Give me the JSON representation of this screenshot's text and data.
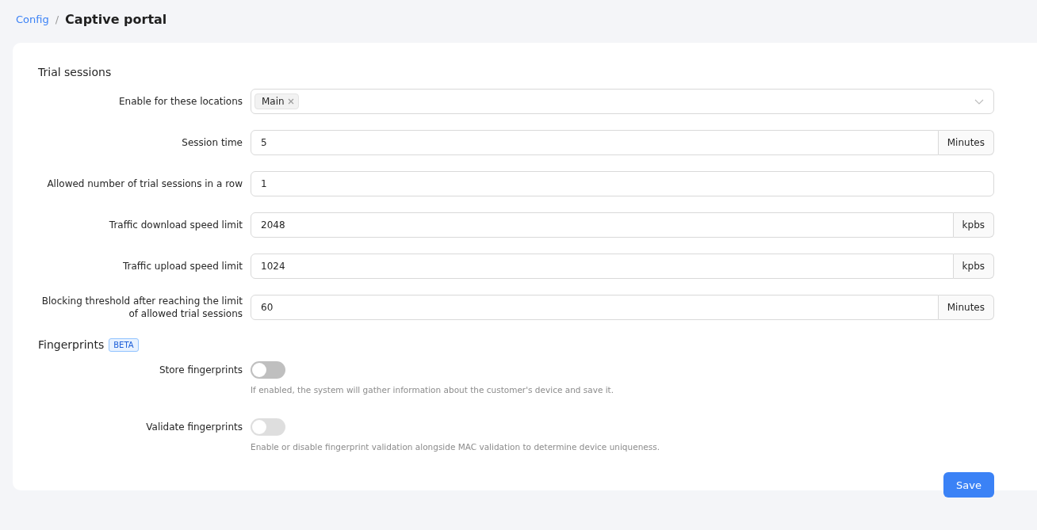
{
  "breadcrumb": {
    "parent": "Config",
    "separator": "/",
    "title": "Captive portal"
  },
  "sections": [
    {
      "title": "Trial sessions",
      "fields": [
        {
          "kind": "multiselect",
          "label": "Enable for these locations",
          "tags": [
            "Main"
          ]
        },
        {
          "kind": "input",
          "label": "Session time",
          "value": "5",
          "suffix": "Minutes"
        },
        {
          "kind": "input",
          "label": "Allowed number of trial sessions in a row",
          "value": "1"
        },
        {
          "kind": "input",
          "label": "Traffic download speed limit",
          "value": "2048",
          "suffix": "kpbs"
        },
        {
          "kind": "input",
          "label": "Traffic upload speed limit",
          "value": "1024",
          "suffix": "kpbs"
        },
        {
          "kind": "input",
          "label": "Blocking threshold after reaching the limit of allowed trial sessions",
          "value": "60",
          "suffix": "Minutes"
        }
      ]
    },
    {
      "title": "Fingerprints",
      "badge": "BETA",
      "fields": [
        {
          "kind": "toggle",
          "label": "Store fingerprints",
          "on": false,
          "disabled": false,
          "help": "If enabled, the system will gather information about the customer's device and save it."
        },
        {
          "kind": "toggle",
          "label": "Validate fingerprints",
          "on": false,
          "disabled": true,
          "help": "Enable or disable fingerprint validation alongside MAC validation to determine device uniqueness."
        }
      ]
    }
  ],
  "save_button": "Save"
}
